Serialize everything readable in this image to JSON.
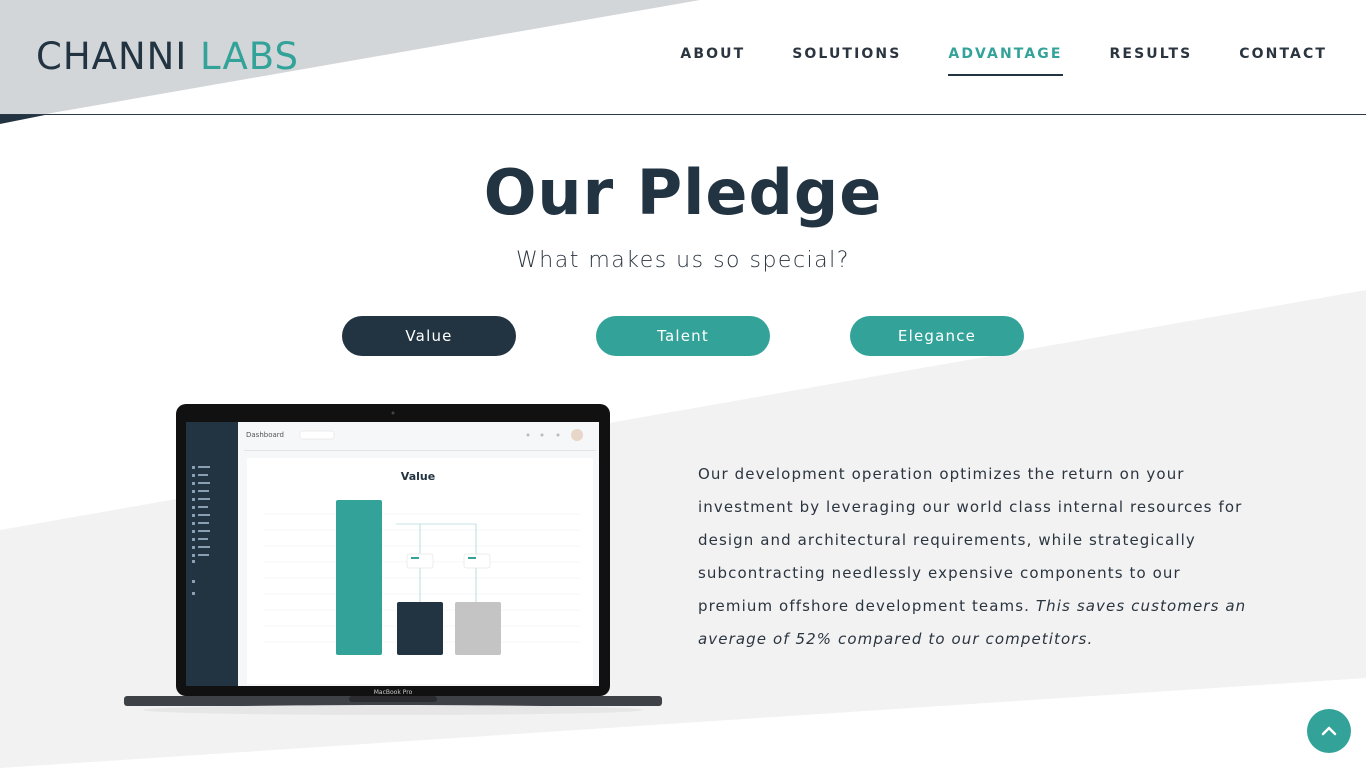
{
  "header": {
    "logo_part1": "CHANNI",
    "logo_part2": "LABS",
    "nav": [
      {
        "label": "ABOUT",
        "active": false
      },
      {
        "label": "SOLUTIONS",
        "active": false
      },
      {
        "label": "ADVANTAGE",
        "active": true
      },
      {
        "label": "RESULTS",
        "active": false
      },
      {
        "label": "CONTACT",
        "active": false
      }
    ]
  },
  "section": {
    "title": "Our Pledge",
    "subtitle": "What makes us so special?",
    "tabs": [
      {
        "label": "Value",
        "active": true
      },
      {
        "label": "Talent",
        "active": false
      },
      {
        "label": "Elegance",
        "active": false
      }
    ],
    "description": "Our development operation optimizes the return on your investment by leveraging our world class internal resources for design and architectural requirements, while strategically subcontracting needlessly expensive components to our premium offshore development teams.",
    "description_italic": "This saves customers an average of 52% compared to our competitors."
  },
  "laptop_screen": {
    "dashboard_label": "Dashboard",
    "chart_title": "Value",
    "device_label": "MacBook Pro"
  },
  "colors": {
    "navy": "#223342",
    "teal": "#33a39a",
    "gray_bar": "#c4c4c4",
    "bg_gray": "#f2f2f2"
  },
  "icons": {
    "scroll_top": "chevron-up-icon"
  }
}
